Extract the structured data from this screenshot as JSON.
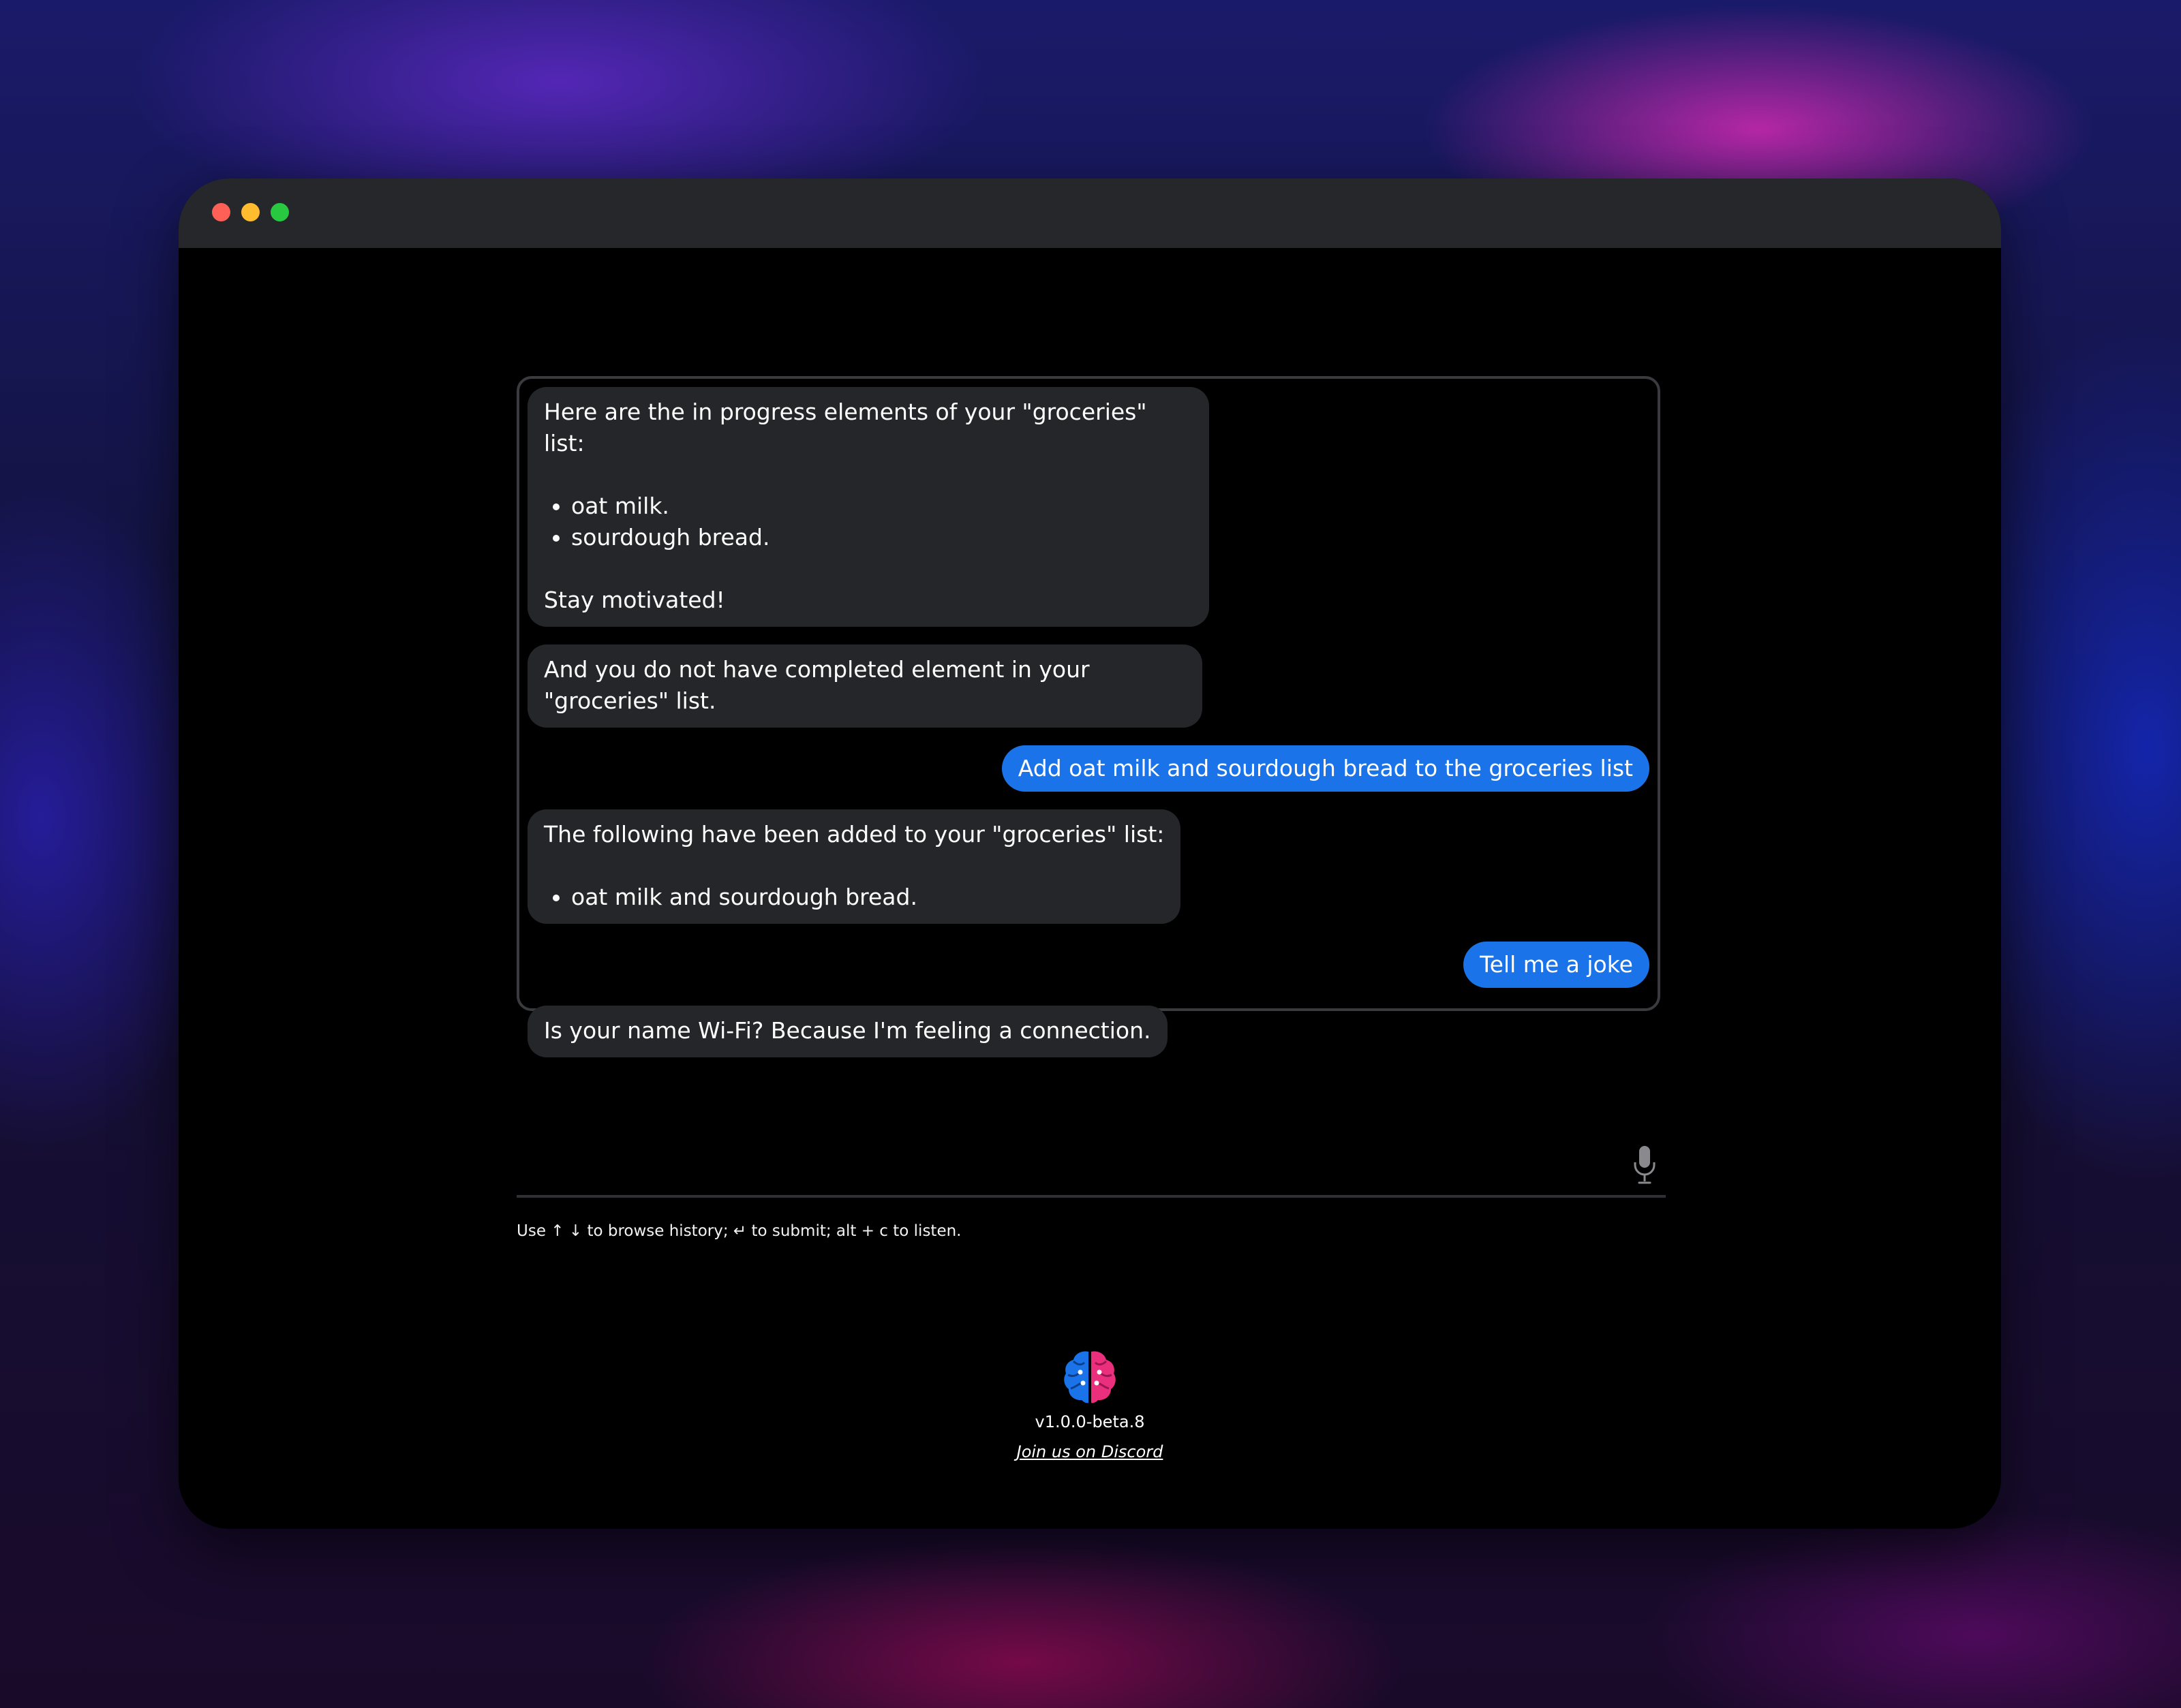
{
  "window": {
    "traffic_lights": [
      "close",
      "minimize",
      "maximize"
    ]
  },
  "chat": {
    "messages": [
      {
        "role": "bot",
        "intro": "Here are the in progress elements of your \"groceries\" list:",
        "items": [
          "oat milk.",
          "sourdough bread."
        ],
        "outro": "Stay motivated!"
      },
      {
        "role": "bot",
        "text": "And you do not have completed element in your \"groceries\" list."
      },
      {
        "role": "user",
        "text": "Add oat milk and sourdough bread to the groceries list"
      },
      {
        "role": "bot",
        "intro": "The following have been added to your \"groceries\" list:",
        "items": [
          "oat milk and sourdough bread."
        ]
      },
      {
        "role": "user",
        "text": "Tell me a joke"
      },
      {
        "role": "bot",
        "text": "Is your name Wi-Fi? Because I'm feeling a connection."
      }
    ]
  },
  "input": {
    "value": "",
    "mic_icon": "microphone-icon",
    "hint": "Use ↑ ↓ to browse history; ↵ to submit; alt + c to listen."
  },
  "footer": {
    "logo_icon": "brain-logo-icon",
    "version": "v1.0.0-beta.8",
    "discord_link": "Join us on Discord"
  },
  "colors": {
    "user_bubble": "#1a73e8",
    "bot_bubble": "#25262a",
    "window_bg": "#000000",
    "titlebar": "#26272b"
  }
}
